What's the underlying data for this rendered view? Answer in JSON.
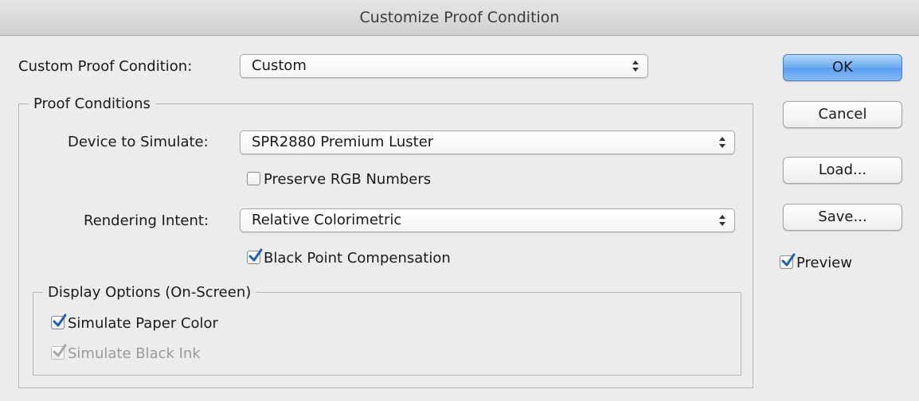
{
  "window": {
    "title": "Customize Proof Condition"
  },
  "custom_proof": {
    "label": "Custom Proof Condition:",
    "value": "Custom"
  },
  "proof_conditions": {
    "legend": "Proof Conditions",
    "device_label": "Device to Simulate:",
    "device_value": "SPR2880 Premium Luster",
    "preserve_rgb": {
      "label": "Preserve RGB Numbers",
      "checked": false
    },
    "intent_label": "Rendering Intent:",
    "intent_value": "Relative Colorimetric",
    "bpc": {
      "label": "Black Point Compensation",
      "checked": true
    }
  },
  "display_options": {
    "legend": "Display Options (On-Screen)",
    "paper": {
      "label": "Simulate Paper Color",
      "checked": true
    },
    "ink": {
      "label": "Simulate Black Ink",
      "checked": true,
      "disabled": true
    }
  },
  "buttons": {
    "ok": "OK",
    "cancel": "Cancel",
    "load": "Load...",
    "save": "Save..."
  },
  "preview": {
    "label": "Preview",
    "checked": true
  },
  "colors": {
    "accent": "#5b9ef0",
    "check": "#1f5fb8",
    "disabled": "#9a9a9a"
  }
}
